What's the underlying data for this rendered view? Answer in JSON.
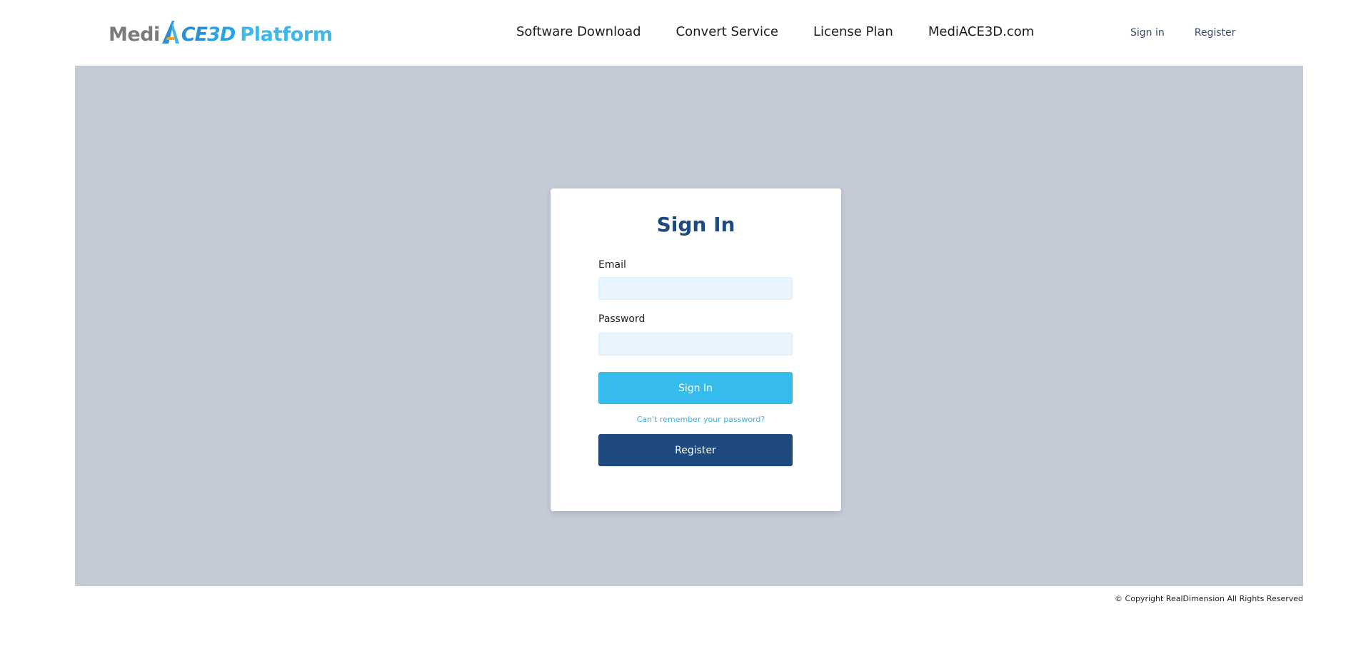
{
  "header": {
    "logo": {
      "medi": "Medi",
      "ace_rest": "CE",
      "three_d": "3D",
      "platform": "Platform",
      "colors": {
        "grey": "#7b7b7b",
        "blue": "#2a8fd4",
        "light_blue": "#3fb7ea",
        "accent_orange": "#f2a31b"
      }
    },
    "nav": [
      {
        "label": "Software Download"
      },
      {
        "label": "Convert Service"
      },
      {
        "label": "License Plan"
      },
      {
        "label": "MediACE3D.com"
      }
    ],
    "auth": {
      "sign_in": "Sign in",
      "register": "Register"
    }
  },
  "signin_card": {
    "title": "Sign In",
    "email_label": "Email",
    "email_value": "",
    "password_label": "Password",
    "password_value": "",
    "signin_button": "Sign In",
    "forgot_link": "Can't remember your password?",
    "register_button": "Register"
  },
  "footer": {
    "copyright": "© Copyright RealDimension All Rights Reserved"
  },
  "colors": {
    "content_bg": "#c4cad6",
    "title": "#1f4a7f",
    "signin_button": "#35bcec",
    "register_button": "#1f4a7f",
    "input_bg": "#e8f5fe",
    "link": "#3cb0e4"
  }
}
